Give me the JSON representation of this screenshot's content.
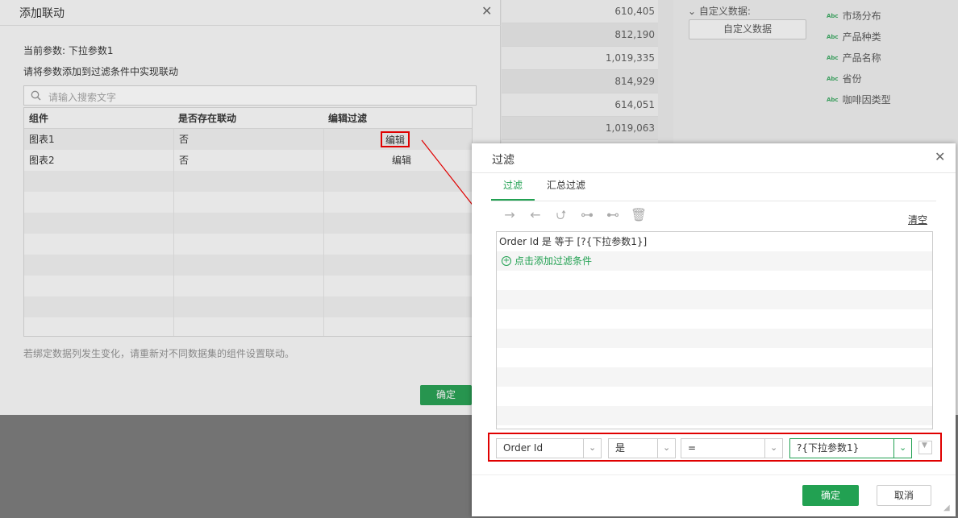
{
  "background": {
    "numbers": [
      "610,405",
      "812,190",
      "1,019,335",
      "814,929",
      "614,051",
      "1,019,063"
    ],
    "custom_section": "自定义数据:",
    "custom_button": "自定义数据",
    "fields": [
      "市场分布",
      "产品种类",
      "产品名称",
      "省份",
      "咖啡因类型"
    ],
    "field_type_badge": "Abc"
  },
  "link_dialog": {
    "title": "添加联动",
    "current_param": "当前参数: 下拉参数1",
    "hint": "请将参数添加到过滤条件中实现联动",
    "search_placeholder": "请输入搜索文字",
    "columns": [
      "组件",
      "是否存在联动",
      "编辑过滤"
    ],
    "rows": [
      {
        "component": "图表1",
        "linked": "否",
        "action": "编辑"
      },
      {
        "component": "图表2",
        "linked": "否",
        "action": "编辑"
      }
    ],
    "note": "若绑定数据列发生变化，请重新对不同数据集的组件设置联动。",
    "ok_label": "确定"
  },
  "filter_dialog": {
    "title": "过滤",
    "tabs": [
      "过滤",
      "汇总过滤"
    ],
    "clear_label": "清空",
    "condition": "Order Id 是 等于 [?{下拉参数1}]",
    "add_condition": "点击添加过滤条件",
    "editor": {
      "field": "Order Id",
      "is": "是",
      "operator": "=",
      "value": "?{下拉参数1}"
    },
    "ok_label": "确定",
    "cancel_label": "取消"
  },
  "colors": {
    "accent_green": "#22a152",
    "highlight_red": "#e00000"
  }
}
